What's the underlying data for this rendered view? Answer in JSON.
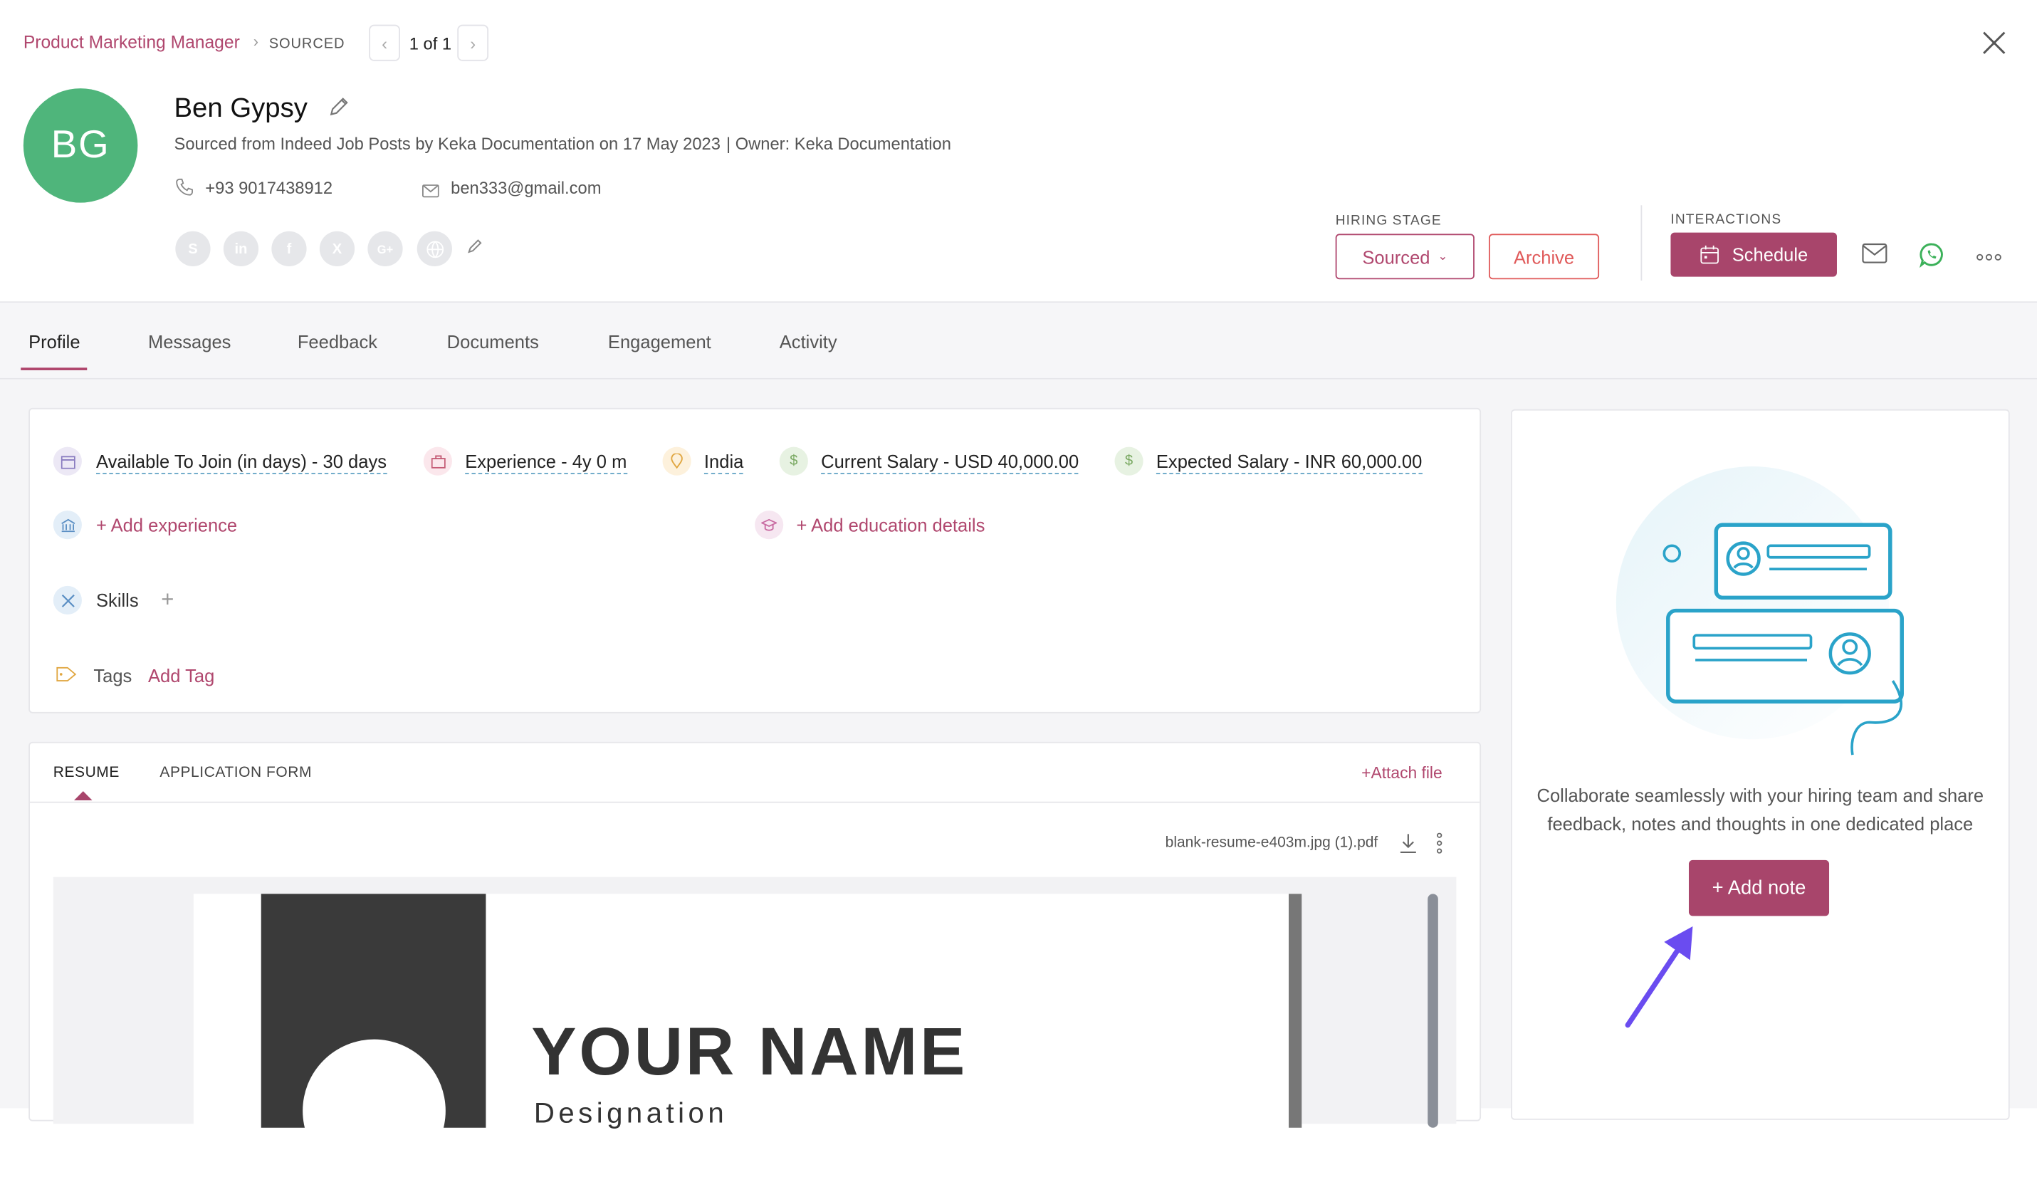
{
  "breadcrumb": {
    "job": "Product Marketing Manager",
    "stage": "SOURCED",
    "pager": "1 of 1"
  },
  "candidate": {
    "initials": "BG",
    "name": "Ben Gypsy",
    "source_line": "Sourced from Indeed Job Posts by Keka Documentation on 17 May 2023",
    "owner": "| Owner: Keka Documentation",
    "phone": "+93 9017438912",
    "email": "ben333@gmail.com",
    "socials": [
      "skype-icon",
      "linkedin-icon",
      "facebook-icon",
      "x-icon",
      "google-plus-icon",
      "globe-icon"
    ]
  },
  "hiring": {
    "label": "HIRING STAGE",
    "stage": "Sourced",
    "archive": "Archive"
  },
  "interactions": {
    "label": "INTERACTIONS",
    "schedule": "Schedule"
  },
  "tabs": [
    "Profile",
    "Messages",
    "Feedback",
    "Documents",
    "Engagement",
    "Activity"
  ],
  "details": {
    "available": "Available To Join (in days) - 30  days",
    "experience": "Experience - 4y 0 m",
    "location": "India",
    "current_salary": "Current Salary - USD 40,000.00",
    "expected_salary": "Expected Salary - INR 60,000.00",
    "add_experience": "+ Add experience",
    "add_education": "+ Add education details",
    "skills": "Skills",
    "tags": "Tags",
    "add_tag": "Add Tag"
  },
  "documents": {
    "tabs": [
      "RESUME",
      "APPLICATION FORM"
    ],
    "attach": "+Attach file",
    "file_name": "blank-resume-e403m.jpg (1).pdf",
    "preview_heading": "YOUR NAME",
    "preview_sub": "Designation"
  },
  "notes": {
    "text_line1": "Collaborate seamlessly with your hiring team and share",
    "text_line2": "feedback, notes and thoughts in one dedicated place",
    "button": "+ Add note"
  },
  "colors": {
    "brand": "#a8456b",
    "avatar": "#4fb57b",
    "arrow": "#6a4cf0"
  }
}
